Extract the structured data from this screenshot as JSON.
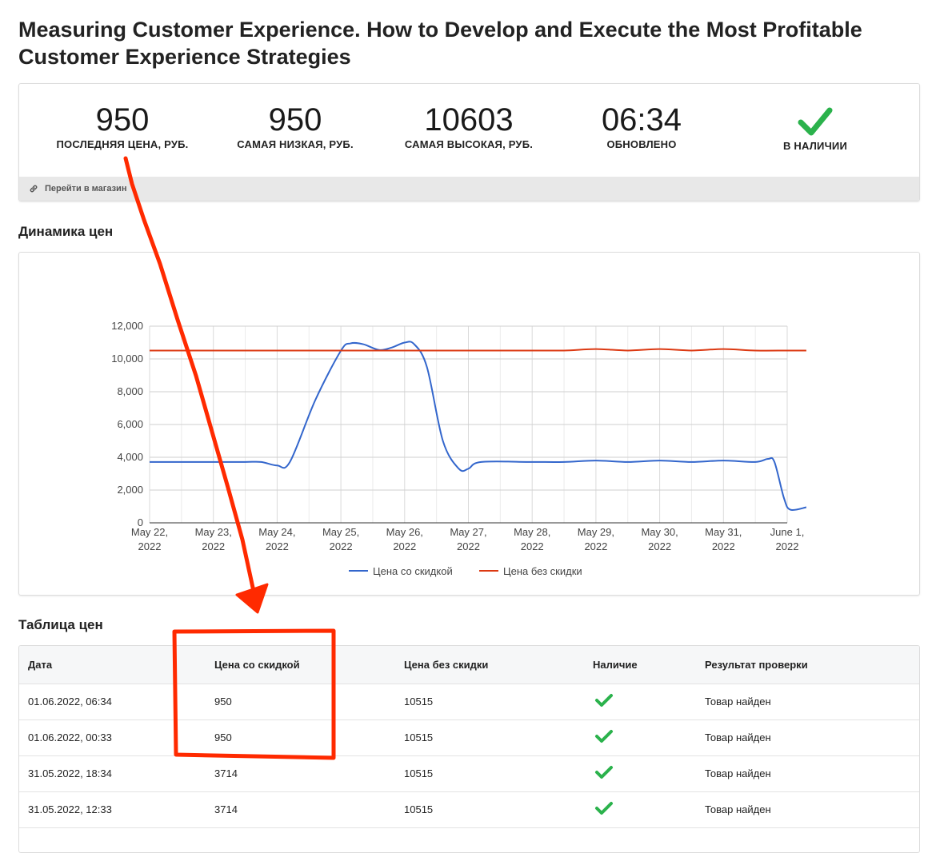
{
  "page": {
    "title": "Measuring Customer Experience. How to Develop and Execute the Most Profitable Customer Experience Strategies"
  },
  "stats": [
    {
      "value": "950",
      "label": "ПОСЛЕДНЯЯ ЦЕНА, РУБ."
    },
    {
      "value": "950",
      "label": "САМАЯ НИЗКАЯ, РУБ."
    },
    {
      "value": "10603",
      "label": "САМАЯ ВЫСОКАЯ, РУБ."
    },
    {
      "value": "06:34",
      "label": "ОБНОВЛЕНО"
    },
    {
      "icon": "check-icon",
      "label": "В НАЛИЧИИ"
    }
  ],
  "store_link": {
    "label": "Перейти в магазин",
    "icon": "link-icon"
  },
  "sections": {
    "chart_title": "Динамика цен",
    "table_title": "Таблица цен"
  },
  "colors": {
    "discount": "#3366cc",
    "regular": "#dc3912",
    "check": "#2bb24c",
    "annotation": "#ff2a00"
  },
  "chart_data": {
    "type": "line",
    "x": [
      "May 22, 2022",
      "May 23, 2022",
      "May 24, 2022",
      "May 25, 2022",
      "May 26, 2022",
      "May 27, 2022",
      "May 28, 2022",
      "May 29, 2022",
      "May 30, 2022",
      "May 31, 2022",
      "June 1, 2022"
    ],
    "x_tick_lines": [
      [
        "May 22,",
        "2022"
      ],
      [
        "May 23,",
        "2022"
      ],
      [
        "May 24,",
        "2022"
      ],
      [
        "May 25,",
        "2022"
      ],
      [
        "May 26,",
        "2022"
      ],
      [
        "May 27,",
        "2022"
      ],
      [
        "May 28,",
        "2022"
      ],
      [
        "May 29,",
        "2022"
      ],
      [
        "May 30,",
        "2022"
      ],
      [
        "May 31,",
        "2022"
      ],
      [
        "June 1,",
        "2022"
      ]
    ],
    "ylim": [
      0,
      12000
    ],
    "y_ticks": [
      0,
      2000,
      4000,
      6000,
      8000,
      10000,
      12000
    ],
    "y_tick_labels": [
      "0",
      "2,000",
      "4,000",
      "6,000",
      "8,000",
      "10,000",
      "12,000"
    ],
    "grid": true,
    "legend": "bottom",
    "series": [
      {
        "name": "Цена со скидкой",
        "points": [
          [
            0,
            3714
          ],
          [
            0.5,
            3714
          ],
          [
            1,
            3714
          ],
          [
            1.5,
            3714
          ],
          [
            1.75,
            3714
          ],
          [
            2,
            3500
          ],
          [
            2.2,
            3714
          ],
          [
            2.6,
            7500
          ],
          [
            3,
            10500
          ],
          [
            3.15,
            10950
          ],
          [
            3.35,
            10900
          ],
          [
            3.6,
            10550
          ],
          [
            3.8,
            10700
          ],
          [
            4,
            11000
          ],
          [
            4.15,
            10900
          ],
          [
            4.35,
            9500
          ],
          [
            4.6,
            5000
          ],
          [
            4.85,
            3300
          ],
          [
            5,
            3300
          ],
          [
            5.2,
            3714
          ],
          [
            6,
            3714
          ],
          [
            6.5,
            3714
          ],
          [
            7,
            3800
          ],
          [
            7.5,
            3714
          ],
          [
            8,
            3800
          ],
          [
            8.5,
            3714
          ],
          [
            9,
            3800
          ],
          [
            9.5,
            3714
          ],
          [
            9.7,
            3900
          ],
          [
            9.8,
            3714
          ],
          [
            9.95,
            1500
          ],
          [
            10.05,
            800
          ],
          [
            10.3,
            950
          ]
        ]
      },
      {
        "name": "Цена без скидки",
        "points": [
          [
            0,
            10515
          ],
          [
            1,
            10515
          ],
          [
            2,
            10515
          ],
          [
            3,
            10515
          ],
          [
            4,
            10515
          ],
          [
            5,
            10515
          ],
          [
            6,
            10515
          ],
          [
            6.5,
            10515
          ],
          [
            7,
            10603
          ],
          [
            7.5,
            10515
          ],
          [
            8,
            10603
          ],
          [
            8.5,
            10515
          ],
          [
            9,
            10603
          ],
          [
            9.5,
            10515
          ],
          [
            10,
            10515
          ],
          [
            10.3,
            10515
          ]
        ]
      }
    ]
  },
  "table": {
    "headers": [
      "Дата",
      "Цена со скидкой",
      "Цена без скидки",
      "Наличие",
      "Результат проверки"
    ],
    "rows": [
      [
        "01.06.2022, 06:34",
        "950",
        "10515",
        "check-icon",
        "Товар найден"
      ],
      [
        "01.06.2022, 00:33",
        "950",
        "10515",
        "check-icon",
        "Товар найден"
      ],
      [
        "31.05.2022, 18:34",
        "3714",
        "10515",
        "check-icon",
        "Товар найден"
      ],
      [
        "31.05.2022, 12:33",
        "3714",
        "10515",
        "check-icon",
        "Товар найден"
      ]
    ]
  }
}
